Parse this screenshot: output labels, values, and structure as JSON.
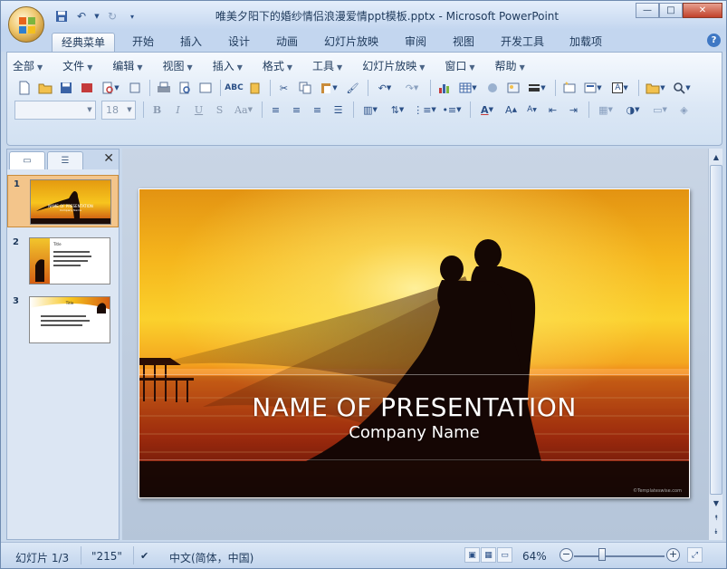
{
  "window": {
    "title": "唯美夕阳下的婚纱情侣浪漫爱情ppt模板.pptx - Microsoft PowerPoint",
    "minimize": "—",
    "maximize": "□",
    "close": "✕"
  },
  "tabs": [
    {
      "label": "经典菜单",
      "active": true
    },
    {
      "label": "开始"
    },
    {
      "label": "插入"
    },
    {
      "label": "设计"
    },
    {
      "label": "动画"
    },
    {
      "label": "幻灯片放映"
    },
    {
      "label": "审阅"
    },
    {
      "label": "视图"
    },
    {
      "label": "开发工具"
    },
    {
      "label": "加载项"
    }
  ],
  "menus": [
    "全部",
    "文件",
    "编辑",
    "视图",
    "插入",
    "格式",
    "工具",
    "幻灯片放映",
    "窗口",
    "帮助"
  ],
  "format": {
    "font_name": "",
    "font_size": "18",
    "bold": "B",
    "italic": "I",
    "underline": "U",
    "strike": "S",
    "change_case": "Aa"
  },
  "slides_pane": {
    "slides": [
      {
        "number": "1",
        "selected": true,
        "title": "NAME OF PRESENTATION",
        "subtitle": "Company Name"
      },
      {
        "number": "2",
        "title": "Title"
      },
      {
        "number": "3",
        "title": "Title"
      }
    ]
  },
  "slide": {
    "title": "NAME OF PRESENTATION",
    "subtitle": "Company Name",
    "watermark": "©Templateswise.com"
  },
  "status": {
    "slide_indicator": "幻灯片 1/3",
    "theme": "\"215\"",
    "language": "中文(简体，中国)",
    "zoom": "64%"
  },
  "colors": {
    "accent": "#f3c58b",
    "ribbon": "#dbe7f5"
  }
}
